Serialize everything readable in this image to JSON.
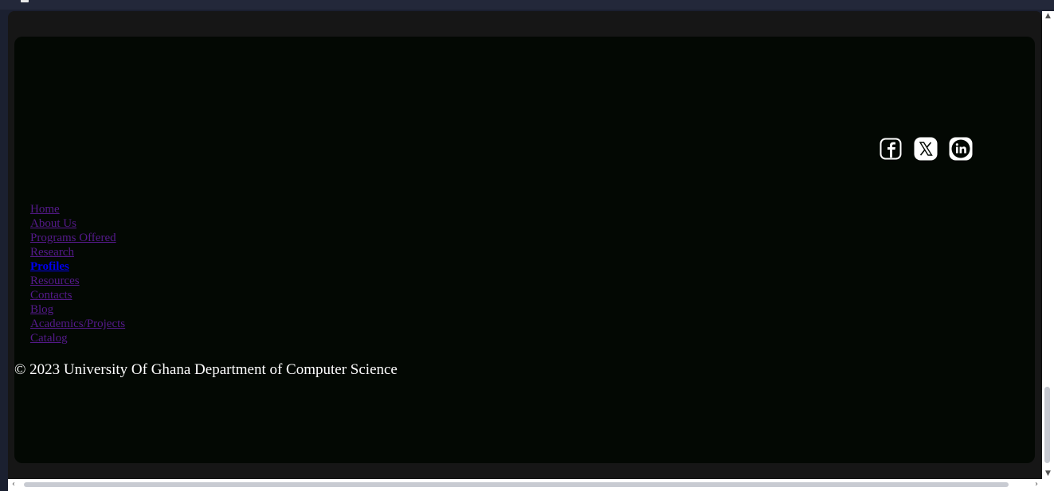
{
  "social": [
    {
      "name": "facebook",
      "icon": "facebook-icon"
    },
    {
      "name": "x",
      "icon": "x-twitter-icon"
    },
    {
      "name": "linkedin",
      "icon": "linkedin-icon"
    }
  ],
  "nav": {
    "items": [
      {
        "label": "Home"
      },
      {
        "label": "About Us"
      },
      {
        "label": "Programs Offered"
      },
      {
        "label": "Research"
      },
      {
        "label": "Profiles",
        "active": true
      },
      {
        "label": "Resources"
      },
      {
        "label": "Contacts"
      },
      {
        "label": "Blog"
      },
      {
        "label": "Academics/Projects"
      },
      {
        "label": "Catalog"
      }
    ]
  },
  "footer": {
    "copyright": "© 2023 University Of Ghana Department of Computer Science"
  },
  "colors": {
    "footer_bg": "#030803",
    "visited_link": "#551a8b",
    "active_link": "#0000ee",
    "text": "#ffffff"
  },
  "scrollbars": {
    "up_arrow": "▲",
    "down_arrow": "▼",
    "left_arrow": "‹",
    "right_arrow": "›"
  }
}
